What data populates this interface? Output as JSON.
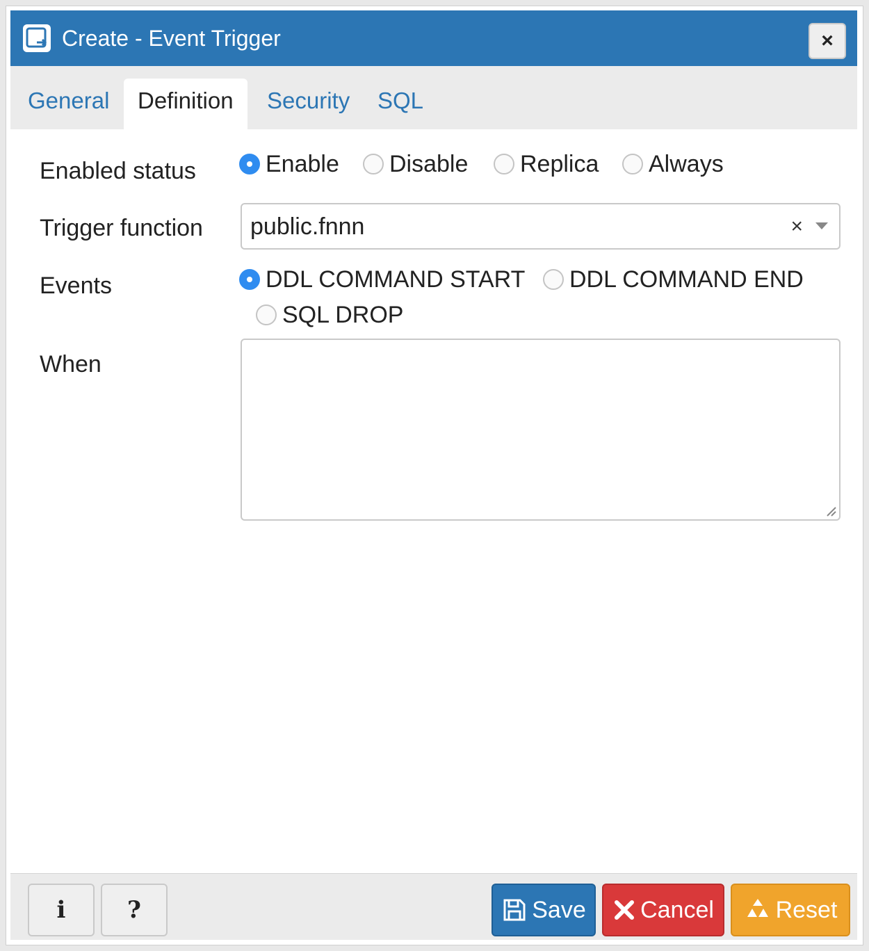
{
  "dialog": {
    "title": "Create - Event Trigger",
    "close_symbol": "×",
    "title_icon": "event-trigger-icon"
  },
  "tabs": [
    {
      "label": "General",
      "active": false
    },
    {
      "label": "Definition",
      "active": true
    },
    {
      "label": "Security",
      "active": false
    },
    {
      "label": "SQL",
      "active": false
    }
  ],
  "form": {
    "enabled_status": {
      "label": "Enabled status",
      "options": [
        "Enable",
        "Disable",
        "Replica",
        "Always"
      ],
      "selected": "Enable"
    },
    "trigger_function": {
      "label": "Trigger function",
      "value": "public.fnnn",
      "clear_symbol": "×"
    },
    "events": {
      "label": "Events",
      "options": [
        "DDL COMMAND START",
        "DDL COMMAND END",
        "SQL DROP"
      ],
      "selected": "DDL COMMAND START"
    },
    "when": {
      "label": "When",
      "value": ""
    }
  },
  "footer": {
    "info_label": "i",
    "help_label": "?",
    "save_label": "Save",
    "cancel_label": "Cancel",
    "reset_label": "Reset"
  },
  "colors": {
    "titlebar": "#2c76b4",
    "radio_checked": "#2f8cf0",
    "save": "#2c76b4",
    "cancel": "#d9393a",
    "reset": "#f0a42c"
  }
}
